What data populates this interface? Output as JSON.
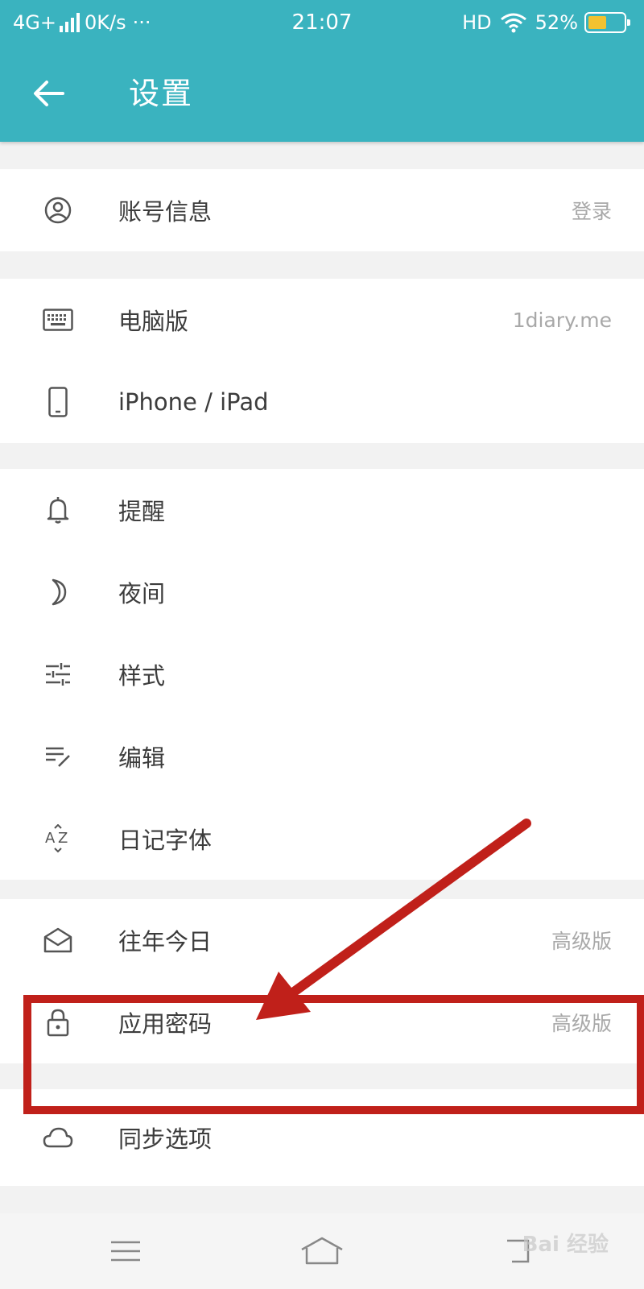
{
  "status_bar": {
    "network": "4G+",
    "speed": "0K/s",
    "more": "···",
    "time": "21:07",
    "hd": "HD",
    "battery": "52%"
  },
  "header": {
    "title": "设置"
  },
  "settings": {
    "account": {
      "label": "账号信息",
      "value": "登录"
    },
    "desktop": {
      "label": "电脑版",
      "value": "1diary.me"
    },
    "iphone": {
      "label": "iPhone / iPad"
    },
    "reminder": {
      "label": "提醒"
    },
    "night": {
      "label": "夜间"
    },
    "style": {
      "label": "样式"
    },
    "edit": {
      "label": "编辑"
    },
    "font": {
      "label": "日记字体"
    },
    "on_this_day": {
      "label": "往年今日",
      "value": "高级版"
    },
    "app_password": {
      "label": "应用密码",
      "value": "高级版"
    },
    "sync": {
      "label": "同步选项"
    }
  },
  "watermark": "Bai 经验",
  "colors": {
    "header": "#3ab3bf",
    "annotation": "#c0201a",
    "battery_fill": "#f2c230"
  }
}
